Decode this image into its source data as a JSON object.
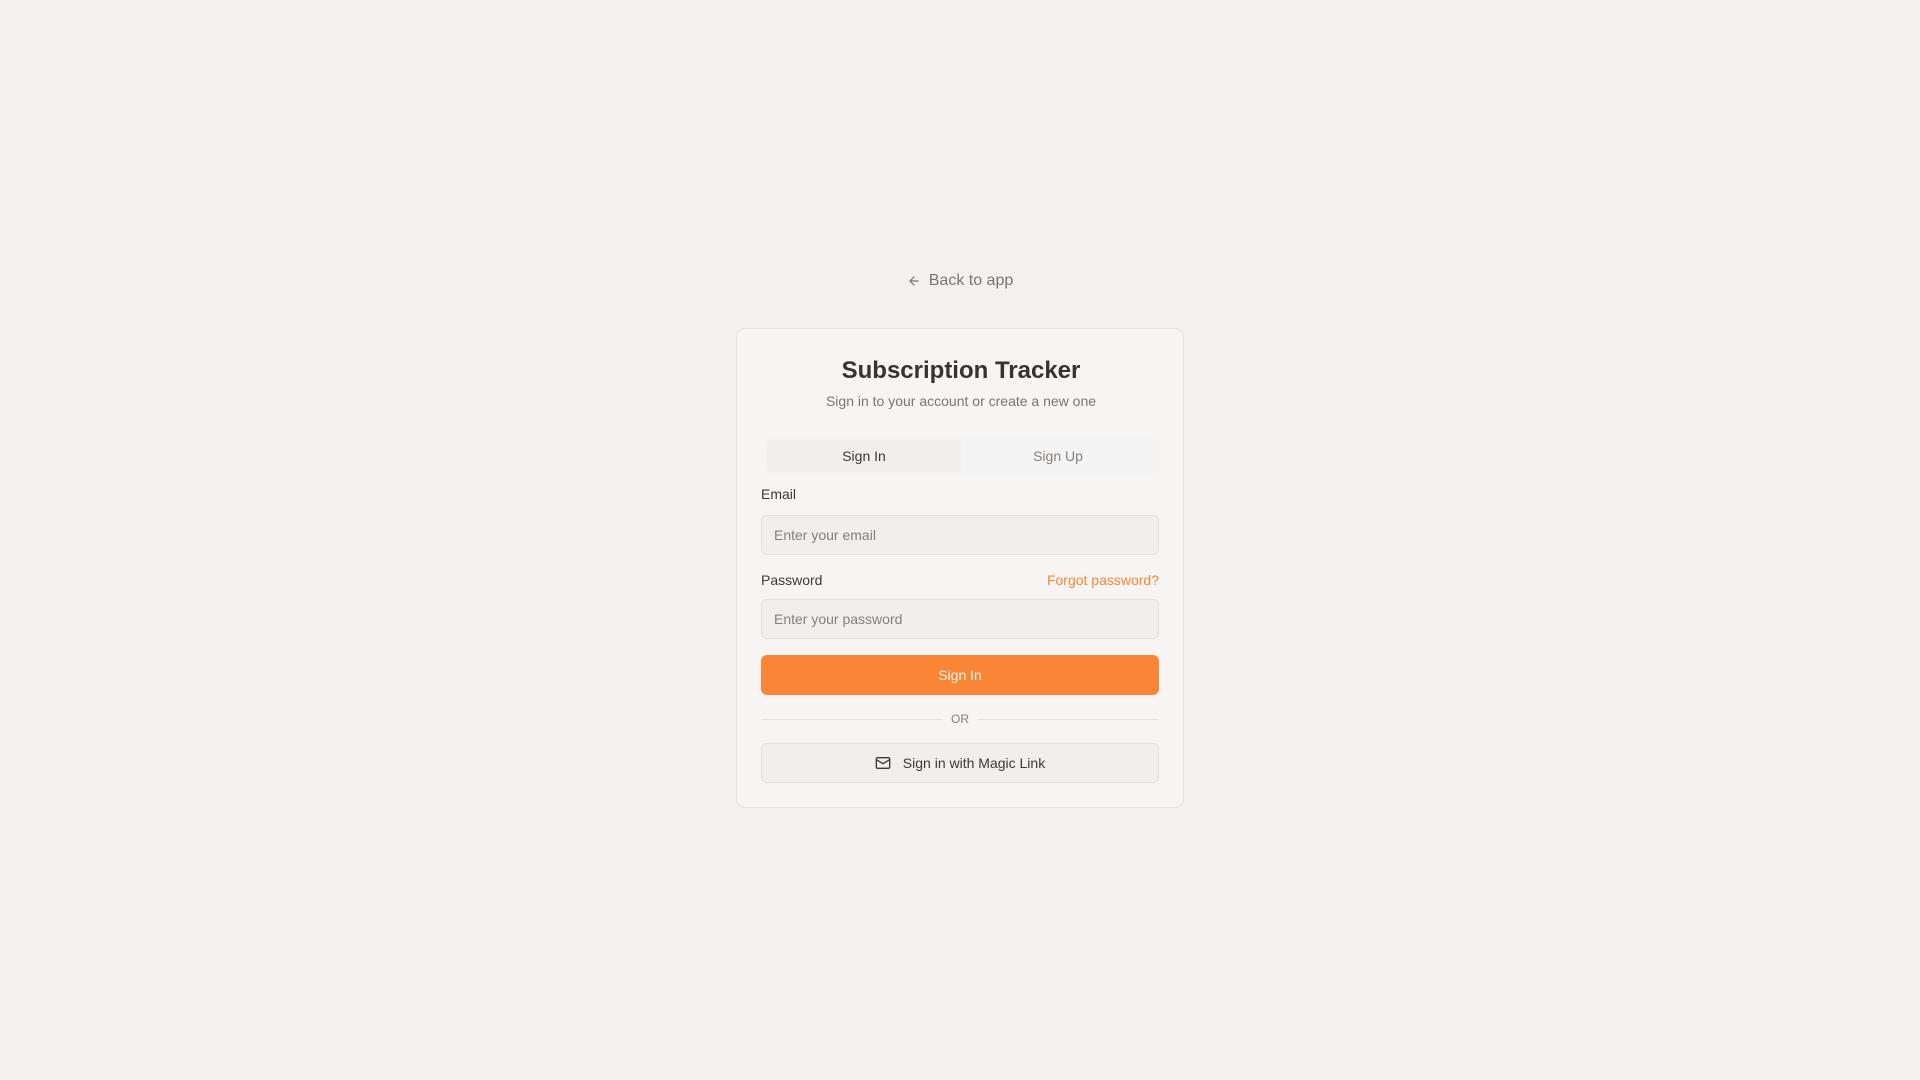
{
  "nav": {
    "back_label": "Back to app"
  },
  "card": {
    "title": "Subscription Tracker",
    "subtitle": "Sign in to your account or create a new one"
  },
  "tabs": [
    {
      "label": "Sign In",
      "active": true
    },
    {
      "label": "Sign Up",
      "active": false
    }
  ],
  "form": {
    "email_label": "Email",
    "email_placeholder": "Enter your email",
    "email_value": "",
    "password_label": "Password",
    "forgot_label": "Forgot password?",
    "password_placeholder": "Enter your password",
    "password_value": "",
    "submit_label": "Sign In",
    "divider_label": "OR",
    "magic_link_label": "Sign in with Magic Link"
  },
  "icons": {
    "back": "arrow-left-icon",
    "magic_link": "mail-icon"
  },
  "colors": {
    "accent": "#fb8536",
    "background": "#f3f1ef",
    "card": "#f7f5f3"
  }
}
